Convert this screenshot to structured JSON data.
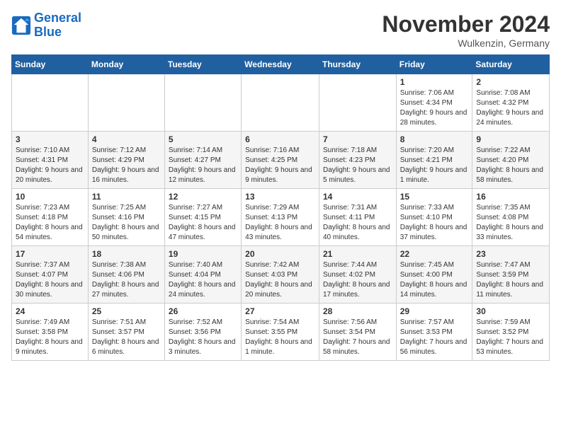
{
  "header": {
    "logo_line1": "General",
    "logo_line2": "Blue",
    "month": "November 2024",
    "location": "Wulkenzin, Germany"
  },
  "days_of_week": [
    "Sunday",
    "Monday",
    "Tuesday",
    "Wednesday",
    "Thursday",
    "Friday",
    "Saturday"
  ],
  "weeks": [
    [
      {
        "day": "",
        "info": ""
      },
      {
        "day": "",
        "info": ""
      },
      {
        "day": "",
        "info": ""
      },
      {
        "day": "",
        "info": ""
      },
      {
        "day": "",
        "info": ""
      },
      {
        "day": "1",
        "info": "Sunrise: 7:06 AM\nSunset: 4:34 PM\nDaylight: 9 hours and 28 minutes."
      },
      {
        "day": "2",
        "info": "Sunrise: 7:08 AM\nSunset: 4:32 PM\nDaylight: 9 hours and 24 minutes."
      }
    ],
    [
      {
        "day": "3",
        "info": "Sunrise: 7:10 AM\nSunset: 4:31 PM\nDaylight: 9 hours and 20 minutes."
      },
      {
        "day": "4",
        "info": "Sunrise: 7:12 AM\nSunset: 4:29 PM\nDaylight: 9 hours and 16 minutes."
      },
      {
        "day": "5",
        "info": "Sunrise: 7:14 AM\nSunset: 4:27 PM\nDaylight: 9 hours and 12 minutes."
      },
      {
        "day": "6",
        "info": "Sunrise: 7:16 AM\nSunset: 4:25 PM\nDaylight: 9 hours and 9 minutes."
      },
      {
        "day": "7",
        "info": "Sunrise: 7:18 AM\nSunset: 4:23 PM\nDaylight: 9 hours and 5 minutes."
      },
      {
        "day": "8",
        "info": "Sunrise: 7:20 AM\nSunset: 4:21 PM\nDaylight: 9 hours and 1 minute."
      },
      {
        "day": "9",
        "info": "Sunrise: 7:22 AM\nSunset: 4:20 PM\nDaylight: 8 hours and 58 minutes."
      }
    ],
    [
      {
        "day": "10",
        "info": "Sunrise: 7:23 AM\nSunset: 4:18 PM\nDaylight: 8 hours and 54 minutes."
      },
      {
        "day": "11",
        "info": "Sunrise: 7:25 AM\nSunset: 4:16 PM\nDaylight: 8 hours and 50 minutes."
      },
      {
        "day": "12",
        "info": "Sunrise: 7:27 AM\nSunset: 4:15 PM\nDaylight: 8 hours and 47 minutes."
      },
      {
        "day": "13",
        "info": "Sunrise: 7:29 AM\nSunset: 4:13 PM\nDaylight: 8 hours and 43 minutes."
      },
      {
        "day": "14",
        "info": "Sunrise: 7:31 AM\nSunset: 4:11 PM\nDaylight: 8 hours and 40 minutes."
      },
      {
        "day": "15",
        "info": "Sunrise: 7:33 AM\nSunset: 4:10 PM\nDaylight: 8 hours and 37 minutes."
      },
      {
        "day": "16",
        "info": "Sunrise: 7:35 AM\nSunset: 4:08 PM\nDaylight: 8 hours and 33 minutes."
      }
    ],
    [
      {
        "day": "17",
        "info": "Sunrise: 7:37 AM\nSunset: 4:07 PM\nDaylight: 8 hours and 30 minutes."
      },
      {
        "day": "18",
        "info": "Sunrise: 7:38 AM\nSunset: 4:06 PM\nDaylight: 8 hours and 27 minutes."
      },
      {
        "day": "19",
        "info": "Sunrise: 7:40 AM\nSunset: 4:04 PM\nDaylight: 8 hours and 24 minutes."
      },
      {
        "day": "20",
        "info": "Sunrise: 7:42 AM\nSunset: 4:03 PM\nDaylight: 8 hours and 20 minutes."
      },
      {
        "day": "21",
        "info": "Sunrise: 7:44 AM\nSunset: 4:02 PM\nDaylight: 8 hours and 17 minutes."
      },
      {
        "day": "22",
        "info": "Sunrise: 7:45 AM\nSunset: 4:00 PM\nDaylight: 8 hours and 14 minutes."
      },
      {
        "day": "23",
        "info": "Sunrise: 7:47 AM\nSunset: 3:59 PM\nDaylight: 8 hours and 11 minutes."
      }
    ],
    [
      {
        "day": "24",
        "info": "Sunrise: 7:49 AM\nSunset: 3:58 PM\nDaylight: 8 hours and 9 minutes."
      },
      {
        "day": "25",
        "info": "Sunrise: 7:51 AM\nSunset: 3:57 PM\nDaylight: 8 hours and 6 minutes."
      },
      {
        "day": "26",
        "info": "Sunrise: 7:52 AM\nSunset: 3:56 PM\nDaylight: 8 hours and 3 minutes."
      },
      {
        "day": "27",
        "info": "Sunrise: 7:54 AM\nSunset: 3:55 PM\nDaylight: 8 hours and 1 minute."
      },
      {
        "day": "28",
        "info": "Sunrise: 7:56 AM\nSunset: 3:54 PM\nDaylight: 7 hours and 58 minutes."
      },
      {
        "day": "29",
        "info": "Sunrise: 7:57 AM\nSunset: 3:53 PM\nDaylight: 7 hours and 56 minutes."
      },
      {
        "day": "30",
        "info": "Sunrise: 7:59 AM\nSunset: 3:52 PM\nDaylight: 7 hours and 53 minutes."
      }
    ]
  ]
}
